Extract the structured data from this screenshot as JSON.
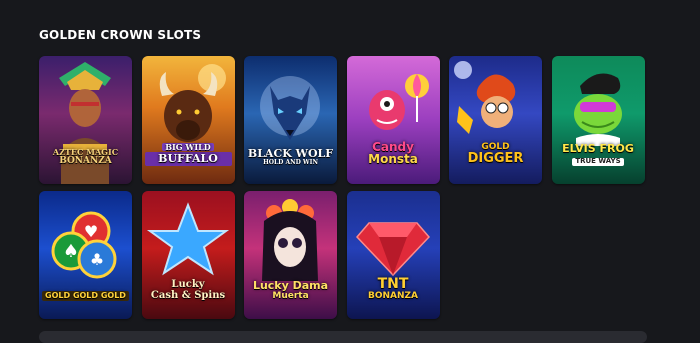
{
  "section": {
    "title": "GOLDEN CROWN SLOTS"
  },
  "games": [
    {
      "id": "aztec",
      "title": "Aztec Magic Bonanza",
      "label_line1": "AZTEC MAGIC",
      "label_line2": "BONANZA",
      "label_color": "#f5d27a"
    },
    {
      "id": "buffalo",
      "title": "Big Wild Buffalo",
      "label_line1": "BIG WILD",
      "label_line2": "BUFFALO",
      "label_color": "#ffffff"
    },
    {
      "id": "wolf",
      "title": "Black Wolf Hold and Win",
      "label_line1": "BLACK WOLF",
      "label_line2": "HOLD AND WIN",
      "label_color": "#ffffff"
    },
    {
      "id": "candy",
      "title": "Candy Monsta",
      "label_line1": "Candy",
      "label_line2": "Monsta",
      "label_color": "#ffd84a"
    },
    {
      "id": "digger",
      "title": "Gold Digger",
      "label_line1": "GOLD",
      "label_line2": "DIGGER",
      "label_color": "#ffc21a"
    },
    {
      "id": "frog",
      "title": "Elvis Frog TrueWays",
      "label_line1": "ELVIS FROG",
      "label_line2": "TRUE WAYS",
      "label_color": "#ffe84a"
    },
    {
      "id": "gold",
      "title": "Gold Gold Gold",
      "label_line1": "GOLD GOLD GOLD",
      "label_line2": "",
      "label_color": "#ffd23a"
    },
    {
      "id": "lucky",
      "title": "Lucky Cash & Spins",
      "label_line1": "Lucky",
      "label_line2": "Cash & Spins",
      "label_color": "#fff2c4"
    },
    {
      "id": "dama",
      "title": "Lucky Dama Muerta",
      "label_line1": "Lucky Dama",
      "label_line2": "Muerta",
      "label_color": "#ffe066"
    },
    {
      "id": "tnt",
      "title": "TNT Bonanza",
      "label_line1": "TNT",
      "label_line2": "BONANZA",
      "label_color": "#ffcf33"
    }
  ]
}
